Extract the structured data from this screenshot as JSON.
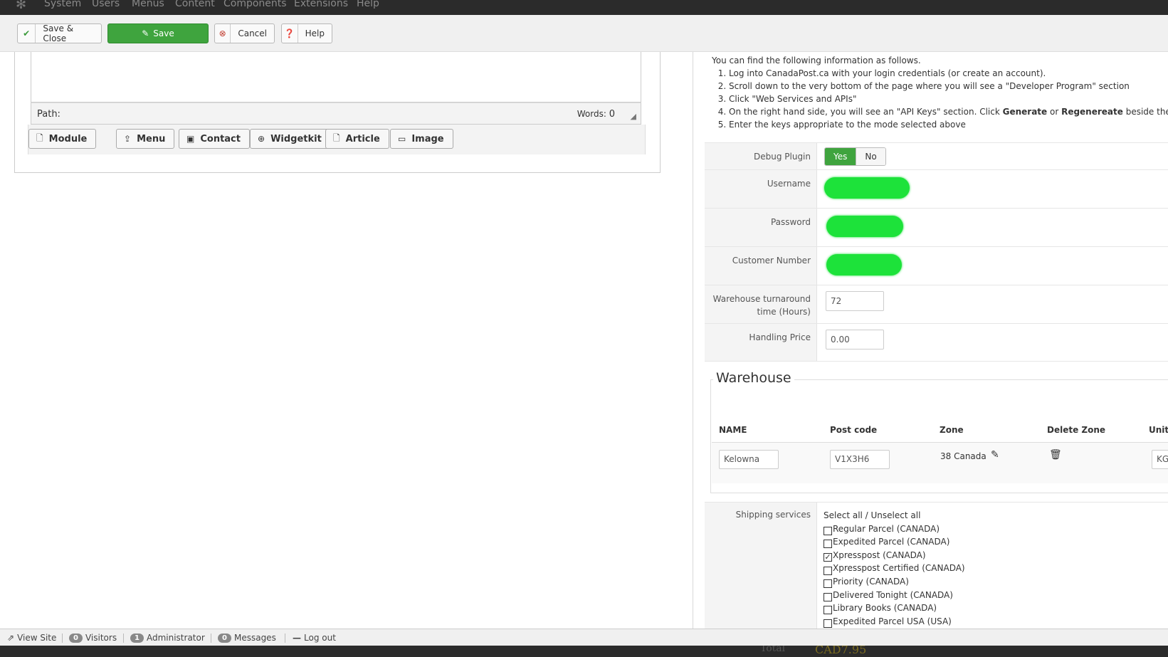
{
  "topbar": {
    "menu": [
      "System",
      "Users",
      "Menus",
      "Content",
      "Components",
      "Extensions",
      "Help"
    ]
  },
  "toolbar": {
    "save_close": "Save & Close",
    "save": "Save",
    "cancel": "Cancel",
    "help": "Help"
  },
  "editor": {
    "path_label": "Path:",
    "words_label": "Words:",
    "words_count": "0",
    "buttons": [
      "Module",
      "Menu",
      "Contact",
      "Widgetkit",
      "Article",
      "Image"
    ]
  },
  "info": {
    "intro": "You can find the following information as follows.",
    "step1": "Log into CanadaPost.ca with your login credentials (or create an account).",
    "step2": "Scroll down to the very bottom of the page where you will see a \"Developer Program\" section",
    "step3": "Click \"Web Services and APIs\"",
    "step4_a": "On the right hand side, you will see an \"API Keys\" section. Click ",
    "step4_generate": "Generate",
    "step4_or": " or ",
    "step4_regenerate": "Regenereate",
    "step4_b": " beside the k",
    "step5": "Enter the keys appropriate to the mode selected above"
  },
  "form": {
    "debug_label": "Debug Plugin",
    "debug_yes": "Yes",
    "debug_no": "No",
    "debug_selected": "Yes",
    "username_label": "Username",
    "password_label": "Password",
    "customer_label": "Customer Number",
    "turnaround_label_1": "Warehouse turnaround",
    "turnaround_label_2": "time (Hours)",
    "turnaround_value": "72",
    "handling_label": "Handling Price",
    "handling_value": "0.00",
    "redaction_color": "#1de23a"
  },
  "warehouse": {
    "legend": "Warehouse",
    "headers": [
      "NAME",
      "Post code",
      "Zone",
      "Delete Zone",
      "Unit"
    ],
    "row": {
      "name": "Kelowna",
      "post_code": "V1X3H6",
      "zone": "38 Canada",
      "unit": "KG"
    }
  },
  "shipping": {
    "label": "Shipping services",
    "select_all": "Select all / Unselect all",
    "services": [
      {
        "label": "Regular Parcel (CANADA)",
        "checked": false
      },
      {
        "label": "Expedited Parcel (CANADA)",
        "checked": false
      },
      {
        "label": "Xpresspost (CANADA)",
        "checked": true
      },
      {
        "label": "Xpresspost Certified (CANADA)",
        "checked": false
      },
      {
        "label": "Priority (CANADA)",
        "checked": false
      },
      {
        "label": "Delivered Tonight (CANADA)",
        "checked": false
      },
      {
        "label": "Library Books (CANADA)",
        "checked": false
      },
      {
        "label": "Expedited Parcel USA (USA)",
        "checked": false
      }
    ]
  },
  "footer": {
    "view_site": "View Site",
    "visitors_count": "0",
    "visitors": "Visitors",
    "admin_count": "1",
    "admin": "Administrator",
    "messages_count": "0",
    "messages": "Messages",
    "logout": "Log out"
  },
  "background_ghost": {
    "text1": "Total",
    "text2": "CAD7.95"
  },
  "colors": {
    "accent_green": "#3fa43e",
    "topbar": "#2b2b2b"
  }
}
